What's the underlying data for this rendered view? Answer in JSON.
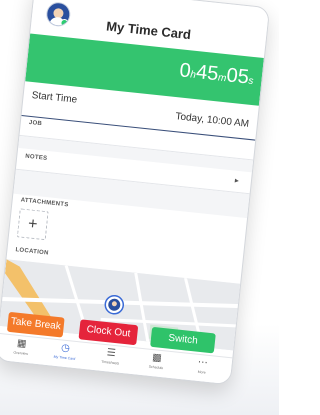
{
  "header": {
    "title": "My Time Card"
  },
  "timer": {
    "hours": "0",
    "hours_unit": "h",
    "minutes": "45",
    "minutes_unit": "m",
    "seconds": "05",
    "seconds_unit": "s"
  },
  "start_time": {
    "label": "Start Time",
    "value": "Today, 10:00 AM"
  },
  "fields": {
    "job_label": "JOB",
    "notes_label": "NOTES",
    "attachments_label": "ATTACHMENTS",
    "location_label": "LOCATION"
  },
  "attachments": {
    "add_symbol": "+"
  },
  "actions": {
    "take_break": "Take Break",
    "clock_out": "Clock Out",
    "switch": "Switch",
    "colors": {
      "take_break": "#f47a2a",
      "clock_out": "#e5243b",
      "switch": "#2fc36a"
    }
  },
  "tabbar": {
    "items": [
      {
        "label": "Overview",
        "icon": "grid-icon"
      },
      {
        "label": "My Time Card",
        "icon": "clock-icon",
        "active": true
      },
      {
        "label": "Timesheets",
        "icon": "timesheets-icon"
      },
      {
        "label": "Schedule",
        "icon": "calendar-icon"
      },
      {
        "label": "More",
        "icon": "more-dots-icon"
      }
    ]
  },
  "colors": {
    "accent_green": "#34c46f",
    "divider_navy": "#3a4f7a",
    "active_tab": "#3b6bd6"
  }
}
